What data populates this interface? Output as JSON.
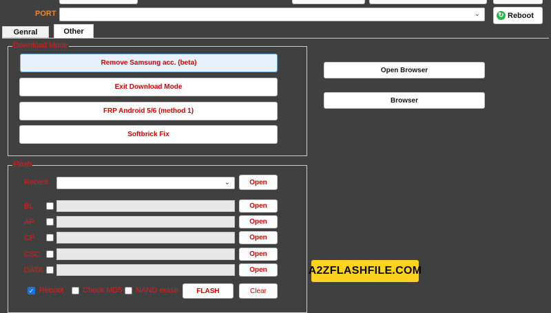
{
  "port": {
    "label": "PORT",
    "value": ""
  },
  "reboot_button": {
    "label": "Reboot"
  },
  "tabs": [
    {
      "label": "Genral",
      "active": false
    },
    {
      "label": "Other",
      "active": true
    }
  ],
  "download_mode": {
    "legend": "Download Mode",
    "buttons": [
      {
        "label": "Remove Samsung acc. (beta)"
      },
      {
        "label": "Exit Download Mode"
      },
      {
        "label": "FRP Android 5/6 (method 1)"
      },
      {
        "label": "Softbrick Fix"
      }
    ]
  },
  "right_buttons": [
    {
      "label": "Open Browser"
    },
    {
      "label": "Browser"
    }
  ],
  "flash": {
    "legend": "Flash",
    "recent": {
      "label": "Recent",
      "value": "",
      "open_label": "Open"
    },
    "rows": [
      {
        "label": "BL",
        "checked": false,
        "value": "",
        "open_label": "Open"
      },
      {
        "label": "AP",
        "checked": false,
        "value": "",
        "open_label": "Open"
      },
      {
        "label": "CP",
        "checked": false,
        "value": "",
        "open_label": "Open"
      },
      {
        "label": "CSC",
        "checked": false,
        "value": "",
        "open_label": "Open"
      },
      {
        "label": "DATA",
        "checked": false,
        "value": "",
        "open_label": "Open"
      }
    ],
    "options": {
      "reboot": {
        "label": "Reboot",
        "checked": true
      },
      "check_md5": {
        "label": "Check MD5",
        "checked": false
      },
      "nand_erase": {
        "label": "NAND erase",
        "checked": false
      }
    },
    "flash_button": "FLASH",
    "clear_button": "Clear"
  },
  "watermark": "A2ZFLASHFILE.COM",
  "icons": {
    "reboot": "refresh-icon",
    "dropdown": "chevron-down-icon",
    "check": "check-icon"
  },
  "colors": {
    "background": "#404040",
    "label_red": "#e01b1b",
    "port_orange": "#e8892e",
    "watermark_yellow": "#ffd21f"
  }
}
